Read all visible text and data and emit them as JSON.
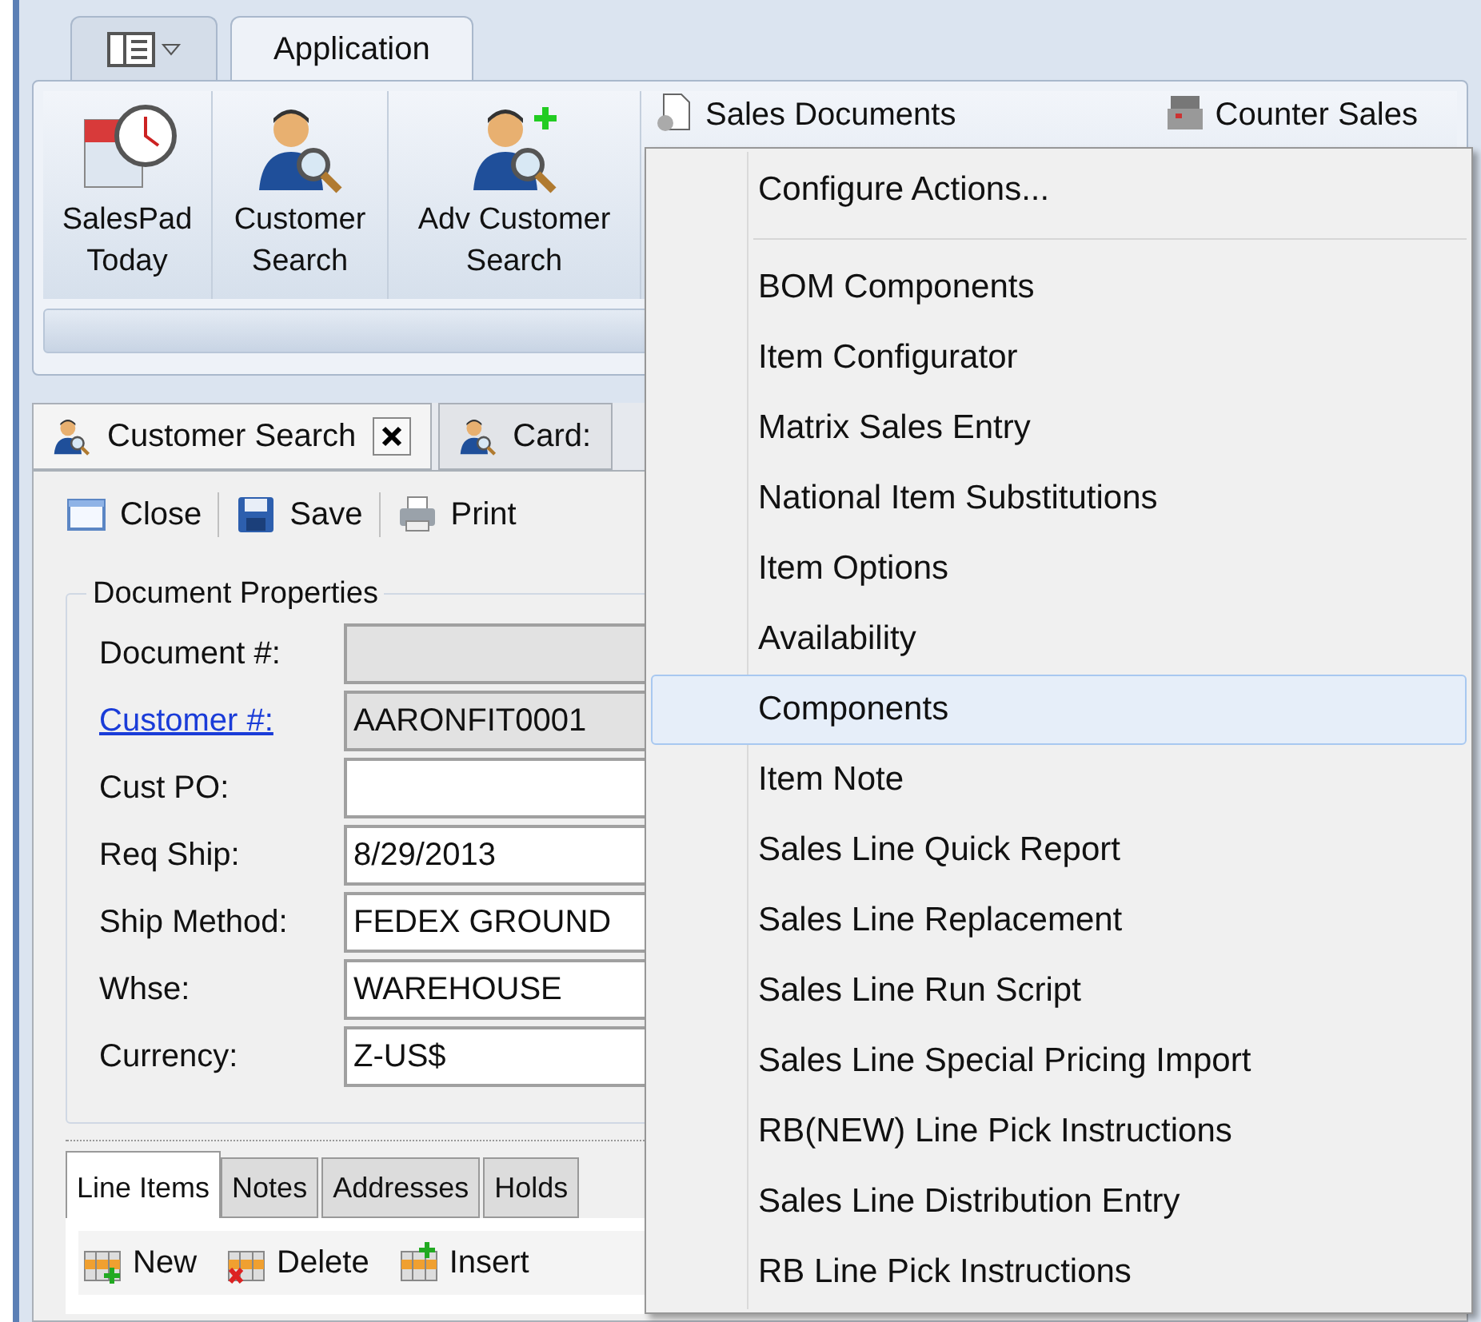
{
  "ribbon_tabs": [
    {
      "kind": "menu",
      "selected": false
    },
    {
      "kind": "text",
      "label": "Application",
      "selected": true
    }
  ],
  "ribbon": {
    "large_buttons": [
      {
        "label": "SalesPad Today"
      },
      {
        "label": "Customer Search"
      },
      {
        "label": "Adv Customer Search"
      }
    ],
    "small_buttons": [
      {
        "label": "Sales Documents"
      },
      {
        "label": "Counter Sales"
      }
    ]
  },
  "document_tabs": [
    {
      "label": "Customer Search",
      "closable": true,
      "selected": true
    },
    {
      "label": "Card:",
      "closable": false,
      "selected": false
    }
  ],
  "toolbar": [
    {
      "label": "Close"
    },
    {
      "label": "Save"
    },
    {
      "label": "Print"
    }
  ],
  "document_properties": {
    "title": "Document Properties",
    "fields": [
      {
        "label": "Document #:",
        "link": false,
        "disabled": true
      },
      {
        "label": "Customer #:",
        "link": true,
        "disabled": true,
        "value": "AARONFIT0001"
      },
      {
        "label": "Cust PO:",
        "link": false,
        "disabled": false
      },
      {
        "label": "Req Ship:",
        "link": false,
        "disabled": false,
        "value": "8/29/2013"
      },
      {
        "label": "Ship Method:",
        "link": false,
        "disabled": false,
        "value": "FEDEX GROUND"
      },
      {
        "label": "Whse:",
        "link": false,
        "disabled": false,
        "value": "WAREHOUSE"
      },
      {
        "label": "Currency:",
        "link": false,
        "disabled": false,
        "value": "Z-US$"
      }
    ]
  },
  "bottom_tabs": [
    {
      "label": "Line Items",
      "selected": true
    },
    {
      "label": "Notes",
      "selected": false
    },
    {
      "label": "Addresses",
      "selected": false
    },
    {
      "label": "Holds",
      "selected": false
    }
  ],
  "line_toolbar": [
    {
      "label": "New"
    },
    {
      "label": "Delete"
    },
    {
      "label": "Insert"
    }
  ],
  "context_menu": {
    "items": [
      {
        "kind": "item",
        "label": "Configure Actions...",
        "selected": false
      },
      {
        "kind": "separator"
      },
      {
        "kind": "item",
        "label": "BOM Components",
        "selected": false
      },
      {
        "kind": "item",
        "label": "Item Configurator",
        "selected": false
      },
      {
        "kind": "item",
        "label": "Matrix Sales Entry",
        "selected": false
      },
      {
        "kind": "item",
        "label": "National Item Substitutions",
        "selected": false
      },
      {
        "kind": "item",
        "label": "Item Options",
        "selected": false
      },
      {
        "kind": "item",
        "label": "Availability",
        "selected": false
      },
      {
        "kind": "item",
        "label": "Components",
        "selected": true
      },
      {
        "kind": "item",
        "label": "Item Note",
        "selected": false
      },
      {
        "kind": "item",
        "label": "Sales Line Quick Report",
        "selected": false
      },
      {
        "kind": "item",
        "label": "Sales Line Replacement",
        "selected": false
      },
      {
        "kind": "item",
        "label": "Sales Line Run Script",
        "selected": false
      },
      {
        "kind": "item",
        "label": "Sales Line Special Pricing Import",
        "selected": false
      },
      {
        "kind": "item",
        "label": "RB(NEW) Line Pick Instructions",
        "selected": false
      },
      {
        "kind": "item",
        "label": "Sales Line Distribution Entry",
        "selected": false
      },
      {
        "kind": "item",
        "label": "RB Line Pick Instructions",
        "selected": false
      }
    ]
  }
}
